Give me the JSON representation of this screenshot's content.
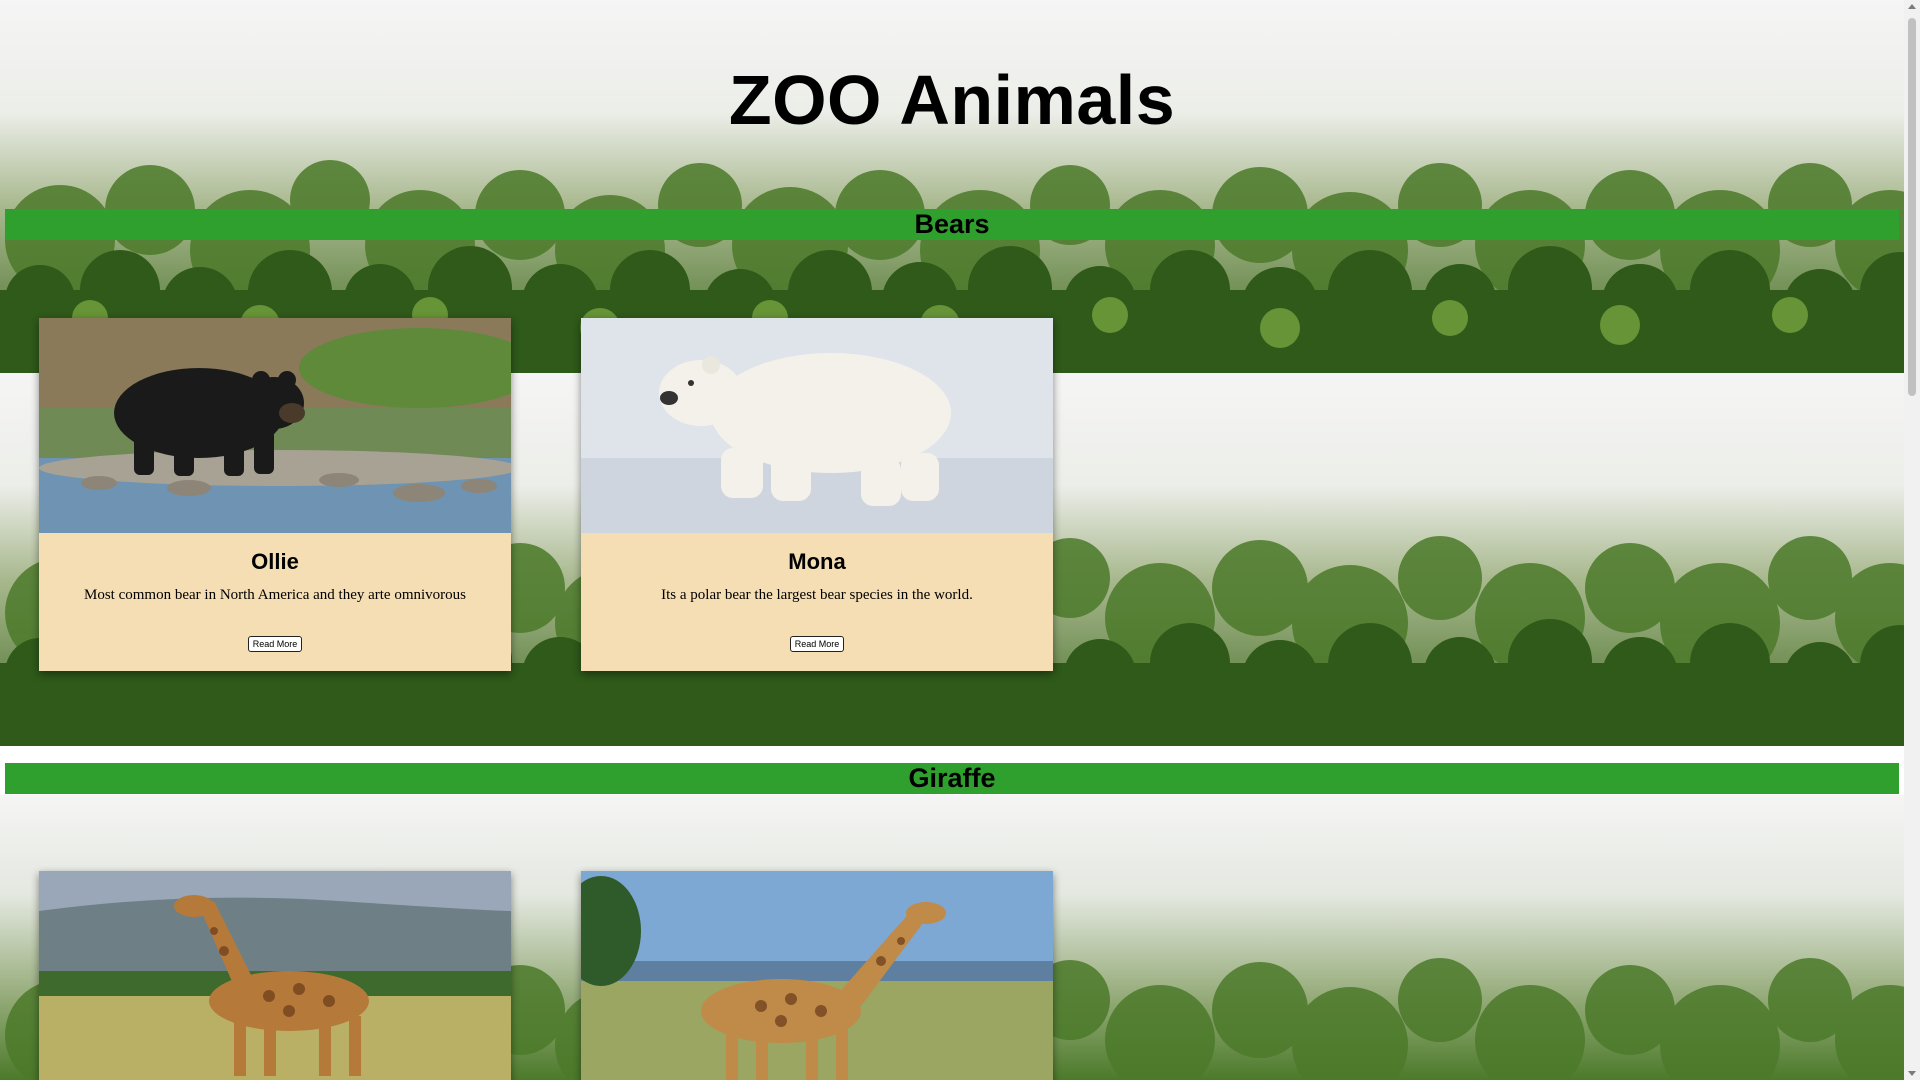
{
  "page": {
    "title": "ZOO Animals"
  },
  "sections": [
    {
      "header": "Bears",
      "cards": [
        {
          "name": "Ollie",
          "description": "Most common bear in North America and they arte omnivorous",
          "button": "Read More",
          "image": "black-bear-photo"
        },
        {
          "name": "Mona",
          "description": "Its a polar bear the largest bear species in the world.",
          "button": "Read More",
          "image": "polar-bear-photo"
        }
      ]
    },
    {
      "header": "Giraffe",
      "cards": [
        {
          "image": "giraffe-photo-1"
        },
        {
          "image": "giraffe-photo-2"
        }
      ]
    }
  ],
  "colors": {
    "section_header_bg": "#2fa02d",
    "card_bg": "#f5deb3",
    "forest_dark": "#2f5a1a",
    "forest_light": "#6d9a3a",
    "mist": "#e8ebe8"
  }
}
